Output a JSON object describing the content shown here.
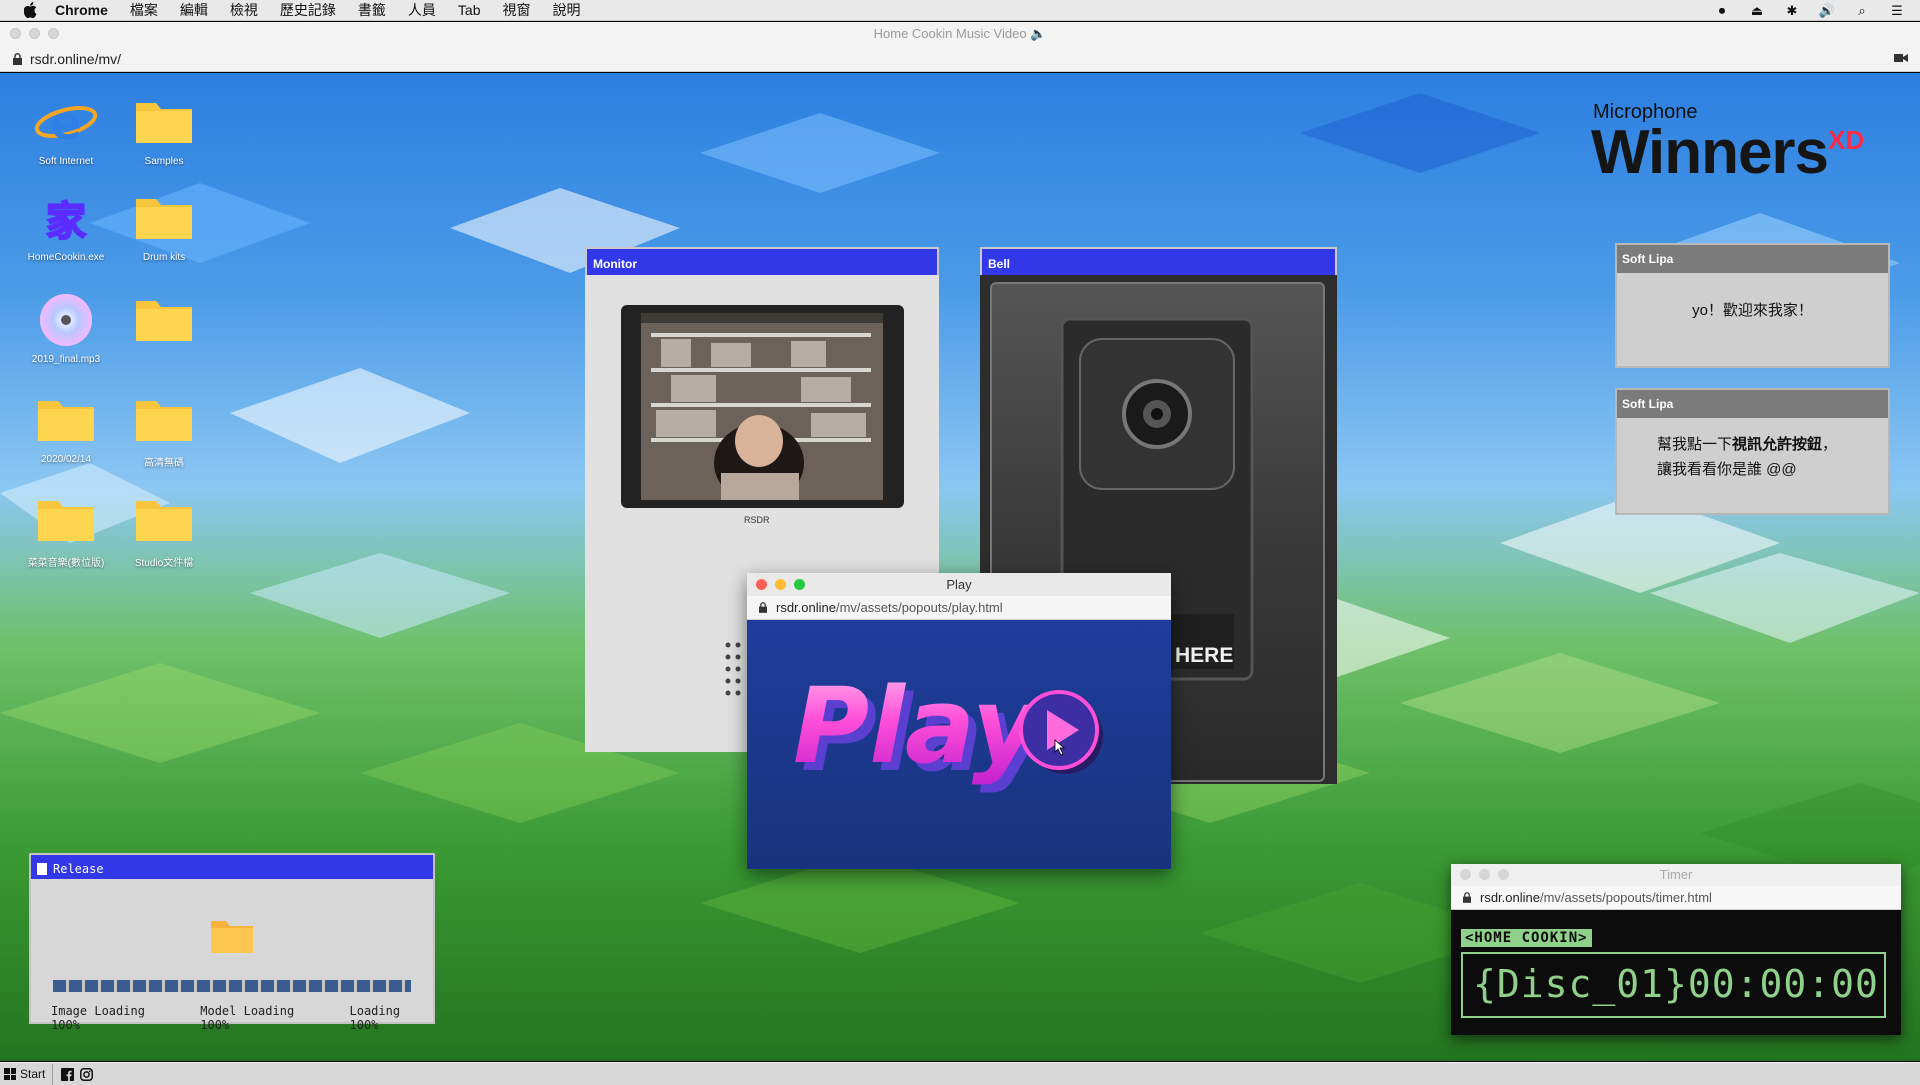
{
  "menubar": {
    "app": "Chrome",
    "items": [
      "檔案",
      "編輯",
      "檢視",
      "歷史記錄",
      "書籤",
      "人員",
      "Tab",
      "視窗",
      "說明"
    ]
  },
  "browser": {
    "title": "Home Cookin Music Video 🔈",
    "url": "rsdr.online/mv/"
  },
  "desktop_icons": [
    {
      "label": "Soft Internet",
      "icon": "soft-internet-icon"
    },
    {
      "label": "Samples",
      "icon": "folder-icon"
    },
    {
      "label": "HomeCookin.exe",
      "icon": "homecookin-exe-icon"
    },
    {
      "label": "Drum kits",
      "icon": "folder-icon"
    },
    {
      "label": "2019_final.mp3",
      "icon": "cd-icon"
    },
    {
      "label": "",
      "icon": "folder-icon"
    },
    {
      "label": "2020/02/14",
      "icon": "folder-icon"
    },
    {
      "label": "高清無碼",
      "icon": "folder-icon"
    },
    {
      "label": "菜菜音樂(數位版)",
      "icon": "folder-icon"
    },
    {
      "label": "Studio文件檔",
      "icon": "folder-icon"
    }
  ],
  "logo": {
    "line1": "Microphone",
    "line2": "Winners",
    "badge": "XD"
  },
  "monitor": {
    "title": "Monitor",
    "caption": "RSDR"
  },
  "bell": {
    "title": "Bell",
    "sign": "HERE"
  },
  "play_popup": {
    "title": "Play",
    "url_host": "rsdr.online",
    "url_path": "/mv/assets/popouts/play.html",
    "text": "Play"
  },
  "chats": [
    {
      "sender": "Soft Lipa",
      "text": "yo！歡迎來我家！"
    },
    {
      "sender": "Soft Lipa",
      "line1_pre": "幫我點一下",
      "line1_bold": "視訊允許按鈕",
      "line1_post": "，",
      "line2": "讓我看看你是誰 @@"
    }
  ],
  "release": {
    "title": "Release",
    "progress": 1.0,
    "stats": [
      "Image Loading 100%",
      "Model Loading 100%",
      "Loading 100%"
    ]
  },
  "timer": {
    "title": "Timer",
    "url_host": "rsdr.online",
    "url_path": "/mv/assets/popouts/timer.html",
    "tag": "<HOME COOKIN>",
    "value": "{Disc_01}00:00:00"
  },
  "taskbar": {
    "start_label": "Start",
    "social": [
      "facebook-icon",
      "instagram-icon"
    ]
  },
  "colors": {
    "window_header": "#3237e8",
    "terminal_green": "#8fd08a",
    "play_pink": "#ff4fd8"
  }
}
